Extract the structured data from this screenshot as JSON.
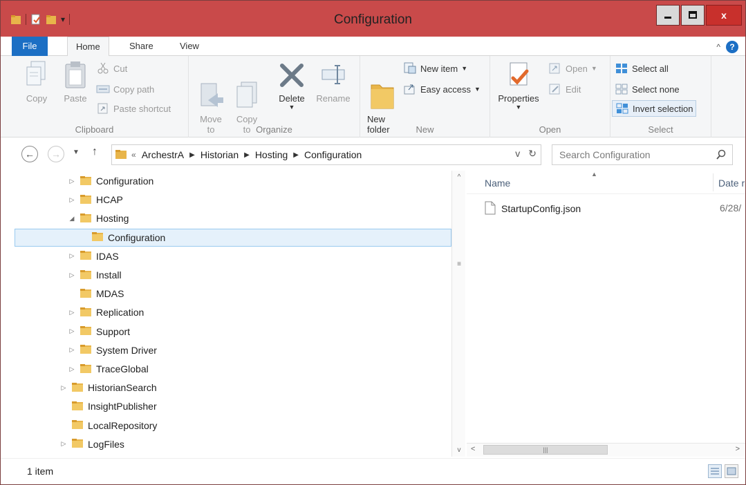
{
  "window": {
    "title": "Configuration",
    "accent_color": "#c94a4a",
    "controls": {
      "minimize": "–",
      "maximize": "☐",
      "close": "x"
    }
  },
  "ribbon_tabs": [
    "File",
    "Home",
    "Share",
    "View"
  ],
  "ribbon": {
    "clipboard": {
      "label": "Clipboard",
      "copy": "Copy",
      "paste": "Paste",
      "cut": "Cut",
      "copy_path": "Copy path",
      "paste_shortcut": "Paste shortcut"
    },
    "organize": {
      "label": "Organize",
      "move_to": "Move\nto",
      "copy_to": "Copy\nto",
      "delete": "Delete",
      "rename": "Rename"
    },
    "new": {
      "label": "New",
      "new_folder": "New\nfolder",
      "new_item": "New item",
      "easy_access": "Easy access"
    },
    "open": {
      "label": "Open",
      "properties": "Properties",
      "open": "Open",
      "edit": "Edit"
    },
    "select": {
      "label": "Select",
      "select_all": "Select all",
      "select_none": "Select none",
      "invert_selection": "Invert selection"
    }
  },
  "address": {
    "overflow": "«",
    "crumbs": [
      "ArchestrA",
      "Historian",
      "Hosting",
      "Configuration"
    ],
    "dropdown": "v",
    "refresh": "↻"
  },
  "search": {
    "placeholder": "Search Configuration"
  },
  "tree": [
    {
      "label": "Configuration",
      "level": 2,
      "expander": "▷",
      "selected": false
    },
    {
      "label": "HCAP",
      "level": 2,
      "expander": "▷",
      "selected": false
    },
    {
      "label": "Hosting",
      "level": 2,
      "expander": "◢",
      "selected": false
    },
    {
      "label": "Configuration",
      "level": 3,
      "expander": "",
      "selected": true
    },
    {
      "label": "IDAS",
      "level": 2,
      "expander": "▷",
      "selected": false
    },
    {
      "label": "Install",
      "level": 2,
      "expander": "▷",
      "selected": false
    },
    {
      "label": "MDAS",
      "level": 2,
      "expander": "",
      "selected": false
    },
    {
      "label": "Replication",
      "level": 2,
      "expander": "▷",
      "selected": false
    },
    {
      "label": "Support",
      "level": 2,
      "expander": "▷",
      "selected": false
    },
    {
      "label": "System Driver",
      "level": 2,
      "expander": "▷",
      "selected": false
    },
    {
      "label": "TraceGlobal",
      "level": 2,
      "expander": "▷",
      "selected": false
    },
    {
      "label": "HistorianSearch",
      "level": 1,
      "expander": "▷",
      "selected": false
    },
    {
      "label": "InsightPublisher",
      "level": 1,
      "expander": "",
      "selected": false
    },
    {
      "label": "LocalRepository",
      "level": 1,
      "expander": "",
      "selected": false
    },
    {
      "label": "LogFiles",
      "level": 1,
      "expander": "▷",
      "selected": false
    }
  ],
  "file_list": {
    "columns": {
      "name": "Name",
      "date": "Date r"
    },
    "files": [
      {
        "name": "StartupConfig.json",
        "date": "6/28/"
      }
    ]
  },
  "status": {
    "items_text": "1 item"
  }
}
